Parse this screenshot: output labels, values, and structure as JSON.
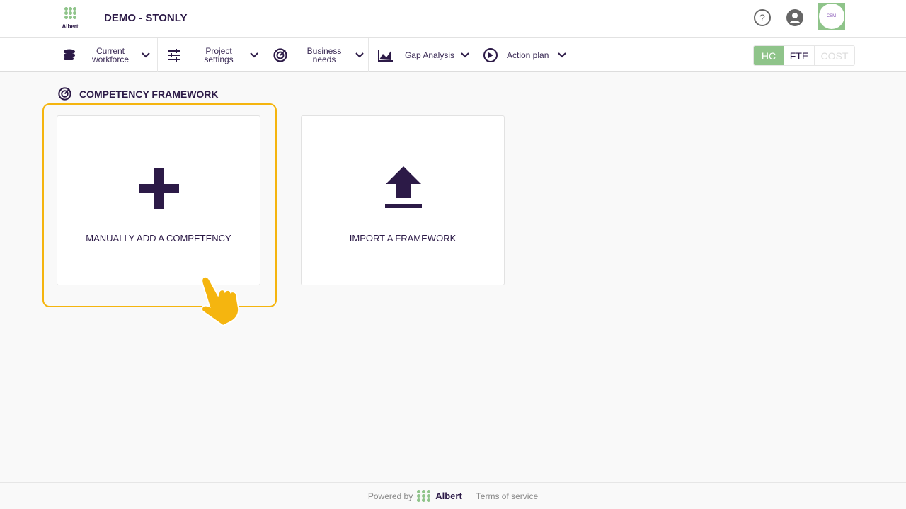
{
  "header": {
    "logo_text": "Albert",
    "title": "DEMO - STONLY",
    "avatar_text": "CSM"
  },
  "nav": [
    {
      "label": "Current workforce"
    },
    {
      "label": "Project settings"
    },
    {
      "label": "Business needs"
    },
    {
      "label": "Gap Analysis"
    },
    {
      "label": "Action plan"
    }
  ],
  "toggle": {
    "options": [
      "HC",
      "FTE",
      "COST"
    ],
    "selected": "HC"
  },
  "section": {
    "title": "COMPETENCY FRAMEWORK"
  },
  "cards": [
    {
      "label": "MANUALLY ADD A COMPETENCY"
    },
    {
      "label": "IMPORT A FRAMEWORK"
    }
  ],
  "footer": {
    "powered_by": "Powered by",
    "brand": "Albert",
    "terms": "Terms of service"
  },
  "colors": {
    "primary": "#2c1a47",
    "accent": "#8fc48a",
    "highlight": "#f5b50f"
  }
}
